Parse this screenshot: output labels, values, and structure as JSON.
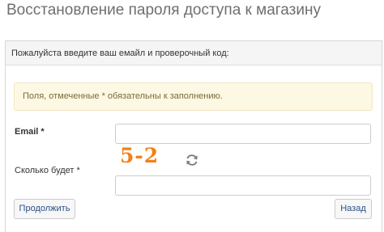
{
  "page": {
    "title": "Восстановление пароля доступа к магазину"
  },
  "panel": {
    "heading": "Пожалуйста введите ваш емайл и проверочный код:",
    "notice": "Поля, отмеченные * обязательны к заполнению."
  },
  "form": {
    "email_label": "Email",
    "captcha_label": "Сколько будет",
    "required_mark": "*",
    "email_value": "",
    "captcha_answer_value": "",
    "captcha_question": "5-2",
    "captcha_color": "#f57f17",
    "refresh_icon": "refresh-icon"
  },
  "buttons": {
    "continue_label": "Продолжить",
    "back_label": "Назад"
  }
}
